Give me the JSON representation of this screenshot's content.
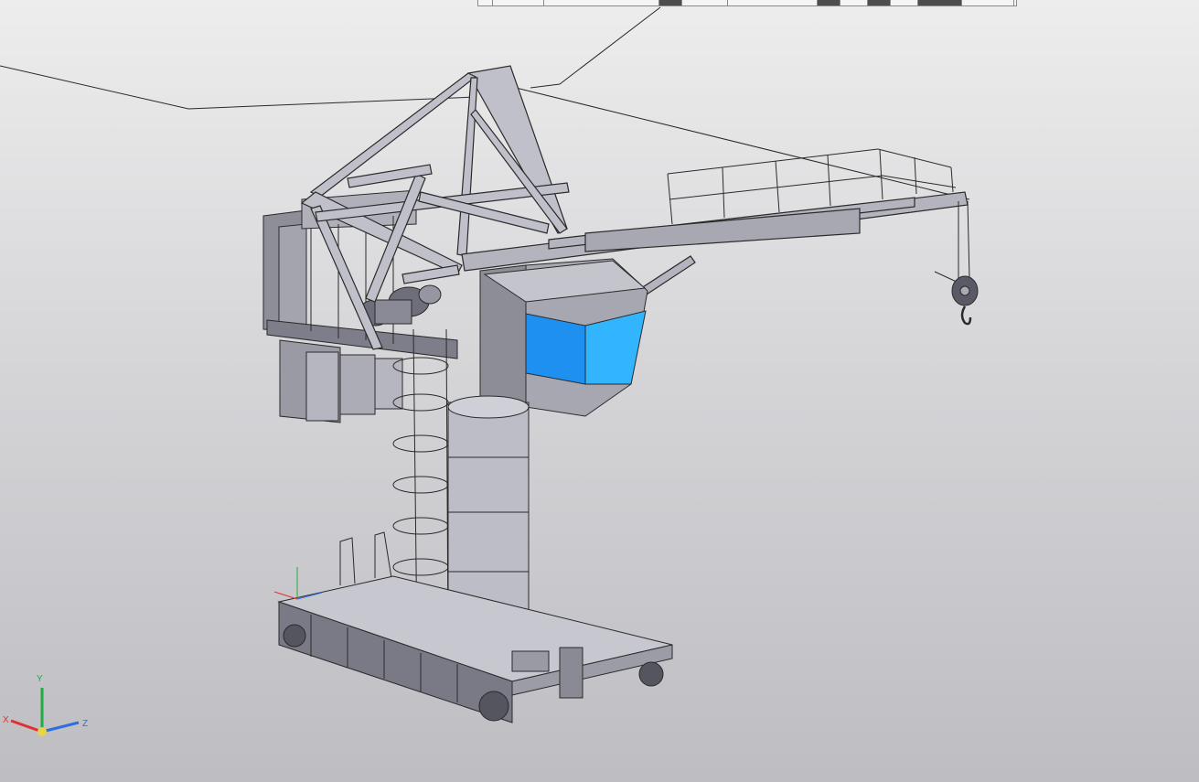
{
  "toolbar": {
    "segments": [
      {
        "w": 16,
        "dark": false
      },
      {
        "w": 56,
        "dark": false
      },
      {
        "w": 126,
        "dark": false
      },
      {
        "w": 25,
        "dark": true
      },
      {
        "w": 50,
        "dark": false
      },
      {
        "w": 98,
        "dark": false
      },
      {
        "w": 25,
        "dark": true
      },
      {
        "w": 30,
        "dark": false
      },
      {
        "w": 25,
        "dark": true
      },
      {
        "w": 30,
        "dark": false
      },
      {
        "w": 48,
        "dark": true
      },
      {
        "w": 57,
        "dark": false
      }
    ]
  },
  "triad": {
    "x_label": "X",
    "y_label": "Y",
    "z_label": "Z",
    "x_color": "#e03030",
    "y_color": "#22aa44",
    "z_color": "#2e6fe0",
    "origin_color": "#e8d44a"
  },
  "model": {
    "cabin_glass_color": "#1e90f0",
    "cabin_glass_light": "#33b4ff",
    "steel_color": "#b8b8c2",
    "edge_color": "#2a2a2a"
  }
}
